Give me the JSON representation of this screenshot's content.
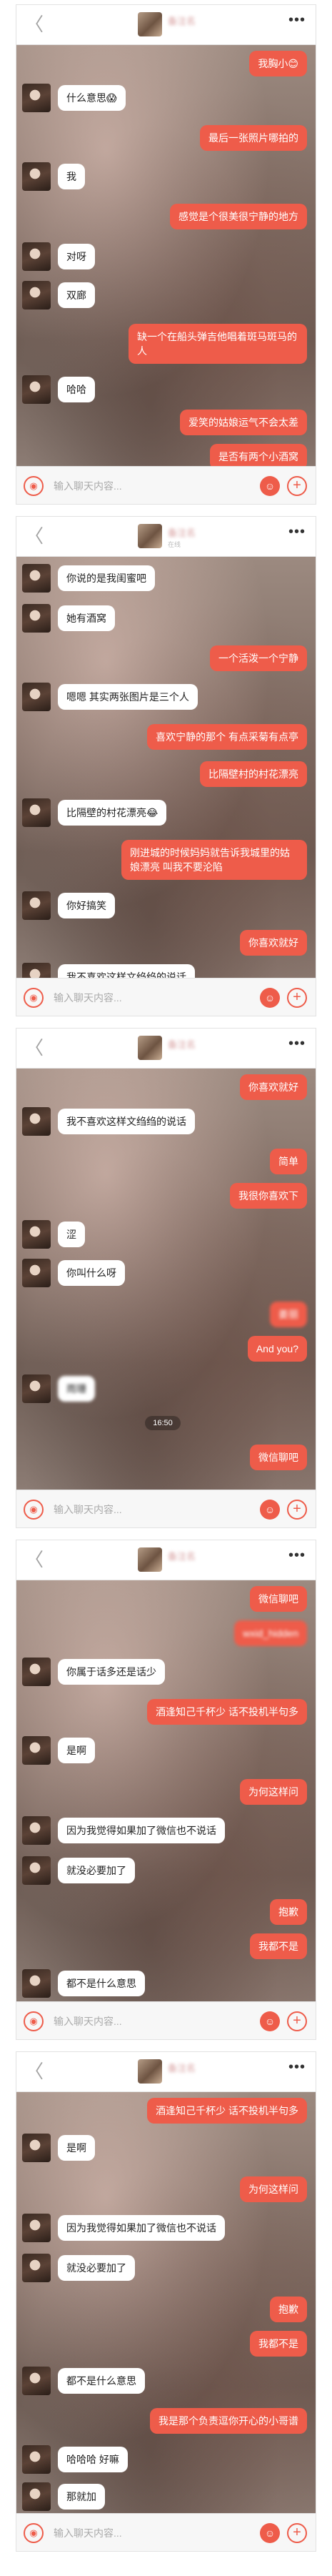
{
  "chat": {
    "contact_name": "备注名",
    "contact_sub": "在线",
    "back_glyph": "〈",
    "more_glyph": "•••",
    "input_placeholder": "输入聊天内容...",
    "voice_glyph": "◉",
    "emoji_glyph": "☺",
    "plus_glyph": "+"
  },
  "screens": [
    {
      "messages": [
        {
          "side": "right",
          "text": "我胸小😊"
        },
        {
          "side": "left",
          "text": "什么意思😱"
        },
        {
          "side": "right",
          "text": "最后一张照片哪拍的"
        },
        {
          "side": "left",
          "text": "我"
        },
        {
          "side": "right",
          "text": "感觉是个很美很宁静的地方"
        },
        {
          "side": "left",
          "text": "对呀"
        },
        {
          "side": "left",
          "text": "双廊"
        },
        {
          "side": "right",
          "text": "缺一个在船头弹吉他唱着斑马斑马的人"
        },
        {
          "side": "left",
          "text": "哈哈"
        },
        {
          "side": "right",
          "text": "爱笑的姑娘运气不会太差"
        },
        {
          "side": "right",
          "text": "是否有两个小酒窝"
        }
      ]
    },
    {
      "messages": [
        {
          "side": "left",
          "text": "你说的是我闺蜜吧"
        },
        {
          "side": "left",
          "text": "她有酒窝"
        },
        {
          "side": "right",
          "text": "一个活泼一个宁静"
        },
        {
          "side": "left",
          "text": "嗯嗯 其实两张图片是三个人"
        },
        {
          "side": "right",
          "text": "喜欢宁静的那个 有点采菊有点亭"
        },
        {
          "side": "right",
          "text": "比隔壁村的村花漂亮"
        },
        {
          "side": "left",
          "text": "比隔壁的村花漂亮😂"
        },
        {
          "side": "right",
          "text": "刚进城的时候妈妈就告诉我城里的姑娘漂亮 叫我不要沦陷"
        },
        {
          "side": "left",
          "text": "你好搞笑"
        },
        {
          "side": "right",
          "text": "你喜欢就好"
        },
        {
          "side": "left",
          "text": "我不喜欢这样文绉绉的说话"
        }
      ]
    },
    {
      "time": "16:50",
      "messages": [
        {
          "side": "right",
          "text": "你喜欢就好"
        },
        {
          "side": "left",
          "text": "我不喜欢这样文绉绉的说话"
        },
        {
          "side": "right",
          "text": "简单"
        },
        {
          "side": "right",
          "text": "我很你喜欢下"
        },
        {
          "side": "left",
          "text": "涩"
        },
        {
          "side": "left",
          "text": "你叫什么呀"
        },
        {
          "side": "right",
          "text": "姜丽"
        },
        {
          "side": "right",
          "text": "And you?"
        },
        {
          "side": "left",
          "text": "雨珊"
        },
        {
          "side": "right",
          "text": "微信聊吧"
        }
      ]
    },
    {
      "messages": [
        {
          "side": "right",
          "text": "微信聊吧"
        },
        {
          "side": "right",
          "text": "wxid_hidden"
        },
        {
          "side": "left",
          "text": "你属于话多还是话少"
        },
        {
          "side": "right",
          "text": "酒逢知己千杯少 话不投机半句多"
        },
        {
          "side": "left",
          "text": "是啊"
        },
        {
          "side": "right",
          "text": "为何这样问"
        },
        {
          "side": "left",
          "text": "因为我觉得如果加了微信也不说话"
        },
        {
          "side": "left",
          "text": "就没必要加了"
        },
        {
          "side": "right",
          "text": "抱歉"
        },
        {
          "side": "right",
          "text": "我都不是"
        },
        {
          "side": "left",
          "text": "都不是什么意思"
        }
      ]
    },
    {
      "messages": [
        {
          "side": "right",
          "text": "酒逢知己千杯少 话不投机半句多"
        },
        {
          "side": "left",
          "text": "是啊"
        },
        {
          "side": "right",
          "text": "为何这样问"
        },
        {
          "side": "left",
          "text": "因为我觉得如果加了微信也不说话"
        },
        {
          "side": "left",
          "text": "就没必要加了"
        },
        {
          "side": "right",
          "text": "抱歉"
        },
        {
          "side": "right",
          "text": "我都不是"
        },
        {
          "side": "left",
          "text": "都不是什么意思"
        },
        {
          "side": "right",
          "text": "我是那个负责逗你开心的小哥谱"
        },
        {
          "side": "left",
          "text": "哈哈哈 好嘛"
        },
        {
          "side": "left",
          "text": "那就加"
        }
      ]
    }
  ]
}
